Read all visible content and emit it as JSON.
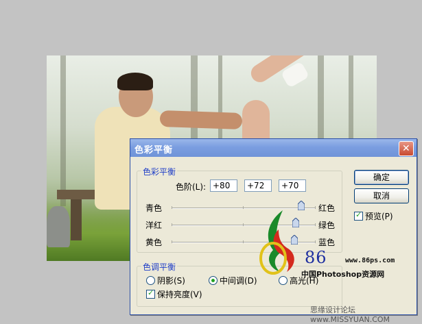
{
  "dialog": {
    "title": "色彩平衡",
    "color_balance_group": {
      "title": "色彩平衡",
      "levels_label": "色阶(L):",
      "levels": [
        "+80",
        "+72",
        "+70"
      ],
      "sliders": [
        {
          "left": "青色",
          "right": "红色",
          "value": 80
        },
        {
          "left": "洋红",
          "right": "绿色",
          "value": 72
        },
        {
          "left": "黄色",
          "right": "蓝色",
          "value": 70
        }
      ]
    },
    "tone_balance_group": {
      "title": "色调平衡",
      "options": [
        "阴影(S)",
        "中间调(D)",
        "高光(H)"
      ],
      "selected": "中间调(D)",
      "preserve_luminosity": "保持亮度(V)",
      "preserve_checked": true
    },
    "buttons": {
      "ok": "确定",
      "cancel": "取消"
    },
    "preview": {
      "label": "预览(P)",
      "checked": true
    }
  },
  "watermark": {
    "number": "86",
    "url": "www.86ps.com",
    "site_name": "中国Photoshop资源网",
    "footer": "思缘设计论坛 www.MISSYUAN.COM"
  },
  "colors": {
    "titlebar": "#7b9ee0",
    "dialog_bg": "#ece9d8",
    "group_title": "#1f3ec7",
    "check": "#21a121"
  }
}
